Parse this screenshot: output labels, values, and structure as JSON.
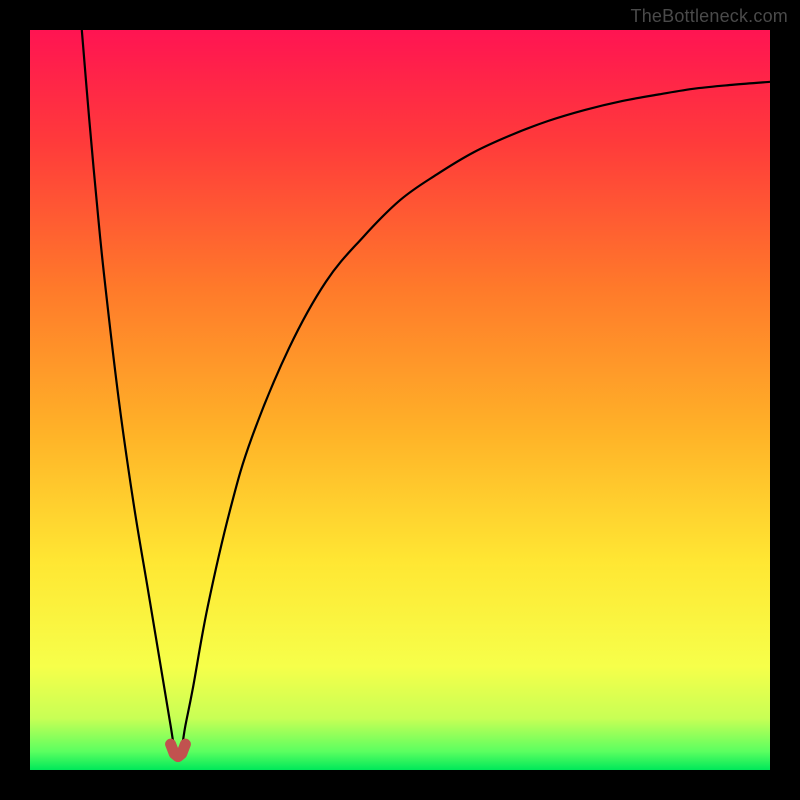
{
  "watermark": {
    "text": "TheBottleneck.com"
  },
  "chart_data": {
    "type": "line",
    "title": "",
    "xlabel": "",
    "ylabel": "",
    "xlim": [
      0,
      100
    ],
    "ylim": [
      0,
      100
    ],
    "series": [
      {
        "name": "curve",
        "x": [
          7,
          8,
          9,
          10,
          12,
          14,
          16,
          18,
          19,
          19.5,
          20,
          20.5,
          21,
          22,
          24,
          27,
          30,
          35,
          40,
          45,
          50,
          55,
          60,
          65,
          70,
          75,
          80,
          85,
          90,
          95,
          100
        ],
        "y": [
          100,
          88,
          77,
          67,
          50,
          36,
          24,
          12,
          6,
          3,
          1.8,
          3,
          6,
          11,
          22,
          35,
          45,
          57,
          66,
          72,
          77,
          80.5,
          83.5,
          85.8,
          87.7,
          89.2,
          90.4,
          91.3,
          92.1,
          92.6,
          93.0
        ]
      },
      {
        "name": "marker-bottom",
        "x": [
          19,
          19.5,
          20,
          20.5,
          21
        ],
        "y": [
          3.5,
          2.2,
          1.8,
          2.2,
          3.5
        ]
      }
    ],
    "gradient_stops": [
      {
        "offset": 0.0,
        "color": "#ff1452"
      },
      {
        "offset": 0.15,
        "color": "#ff3a3b"
      },
      {
        "offset": 0.35,
        "color": "#ff7a2a"
      },
      {
        "offset": 0.55,
        "color": "#ffb428"
      },
      {
        "offset": 0.72,
        "color": "#ffe733"
      },
      {
        "offset": 0.86,
        "color": "#f6ff4a"
      },
      {
        "offset": 0.93,
        "color": "#c8ff55"
      },
      {
        "offset": 0.975,
        "color": "#5bff60"
      },
      {
        "offset": 1.0,
        "color": "#00e85a"
      }
    ],
    "marker_color": "#c1524f",
    "curve_color": "#000000",
    "curve_width": 2.2
  }
}
